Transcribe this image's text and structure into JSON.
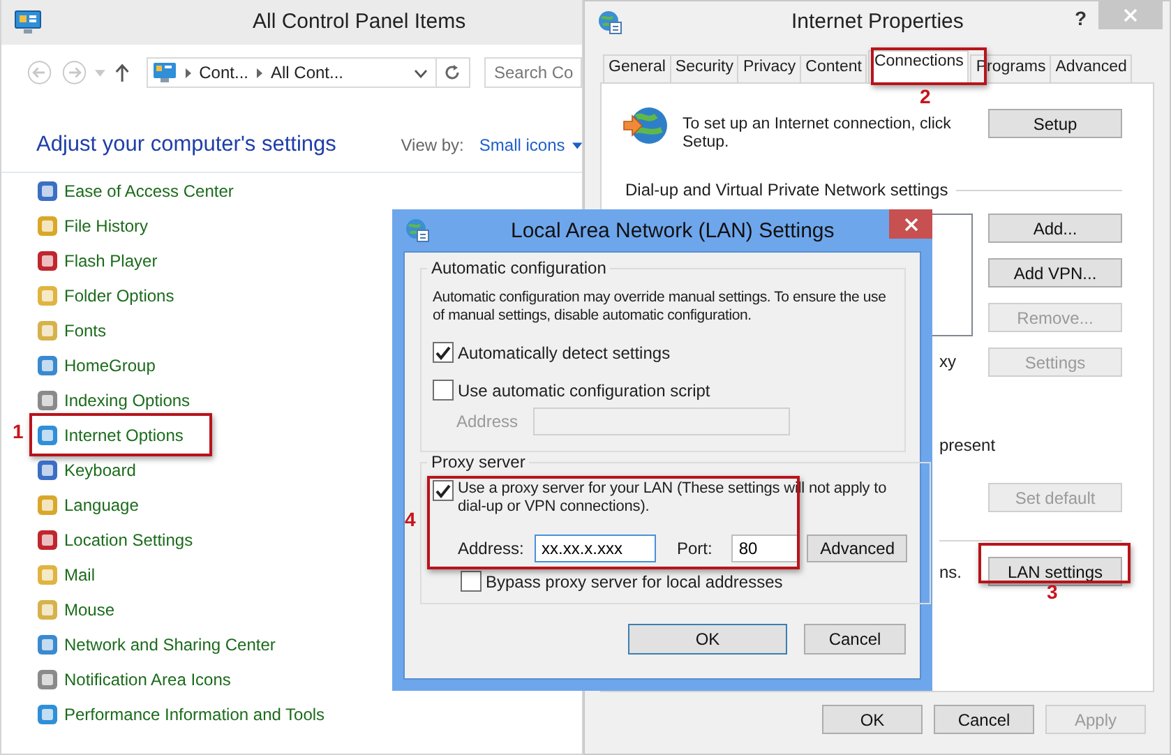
{
  "control_panel": {
    "title": "All Control Panel Items",
    "breadcrumb": [
      "Cont...",
      "All Cont..."
    ],
    "search": {
      "placeholder": "Search Co"
    },
    "heading": "Adjust your computer's settings",
    "view_by": {
      "label": "View by:",
      "value": "Small icons"
    },
    "items": [
      {
        "label": "Ease of Access Center"
      },
      {
        "label": "File History"
      },
      {
        "label": "Flash Player"
      },
      {
        "label": "Folder Options"
      },
      {
        "label": "Fonts"
      },
      {
        "label": "HomeGroup"
      },
      {
        "label": "Indexing Options"
      },
      {
        "label": "Internet Options"
      },
      {
        "label": "Keyboard"
      },
      {
        "label": "Language"
      },
      {
        "label": "Location Settings"
      },
      {
        "label": "Mail"
      },
      {
        "label": "Mouse"
      },
      {
        "label": "Network and Sharing Center"
      },
      {
        "label": "Notification Area Icons"
      },
      {
        "label": "Performance Information and Tools"
      }
    ]
  },
  "internet_properties": {
    "title": "Internet Properties",
    "help": "?",
    "tabs": [
      {
        "label": "General",
        "selected": false
      },
      {
        "label": "Security",
        "selected": false
      },
      {
        "label": "Privacy",
        "selected": false
      },
      {
        "label": "Content",
        "selected": false
      },
      {
        "label": "Connections",
        "selected": true
      },
      {
        "label": "Programs",
        "selected": false
      },
      {
        "label": "Advanced",
        "selected": false
      }
    ],
    "setup_text": "To set up an Internet connection, click Setup.",
    "setup_button": "Setup",
    "dialup_heading": "Dial-up and Virtual Private Network settings",
    "side_buttons": [
      {
        "label": "Add...",
        "disabled": false
      },
      {
        "label": "Add VPN...",
        "disabled": false
      },
      {
        "label": "Remove...",
        "disabled": true
      },
      {
        "label": "Settings",
        "disabled": true
      }
    ],
    "fragments": [
      "xy",
      "present",
      "ns."
    ],
    "set_default": {
      "label": "Set default",
      "disabled": true
    },
    "lan_button": "LAN settings",
    "footer_buttons": [
      {
        "label": "OK",
        "disabled": false
      },
      {
        "label": "Cancel",
        "disabled": false
      },
      {
        "label": "Apply",
        "disabled": true
      }
    ]
  },
  "lan_dialog": {
    "title": "Local Area Network (LAN) Settings",
    "auto_group": {
      "title": "Automatic configuration",
      "description": "Automatic configuration may override manual settings.  To ensure the use of manual settings, disable automatic configuration.",
      "options": [
        {
          "label": "Automatically detect settings",
          "checked": true
        },
        {
          "label": "Use automatic configuration script",
          "checked": false
        }
      ],
      "address": {
        "label": "Address",
        "disabled": true
      }
    },
    "proxy_group": {
      "title": "Proxy server",
      "use_proxy": {
        "label": "Use a proxy server for your LAN (These settings will not apply to dial-up or VPN connections).",
        "checked": true
      },
      "address": {
        "label": "Address:",
        "value": "xx.xx.x.xxx"
      },
      "port": {
        "label": "Port:",
        "value": "80"
      },
      "advanced": "Advanced",
      "bypass": {
        "label": "Bypass proxy server for local addresses",
        "checked": false
      }
    },
    "buttons": [
      "OK",
      "Cancel"
    ]
  },
  "annotations": [
    {
      "label": "1"
    },
    {
      "label": "2"
    },
    {
      "label": "3"
    },
    {
      "label": "4"
    }
  ]
}
